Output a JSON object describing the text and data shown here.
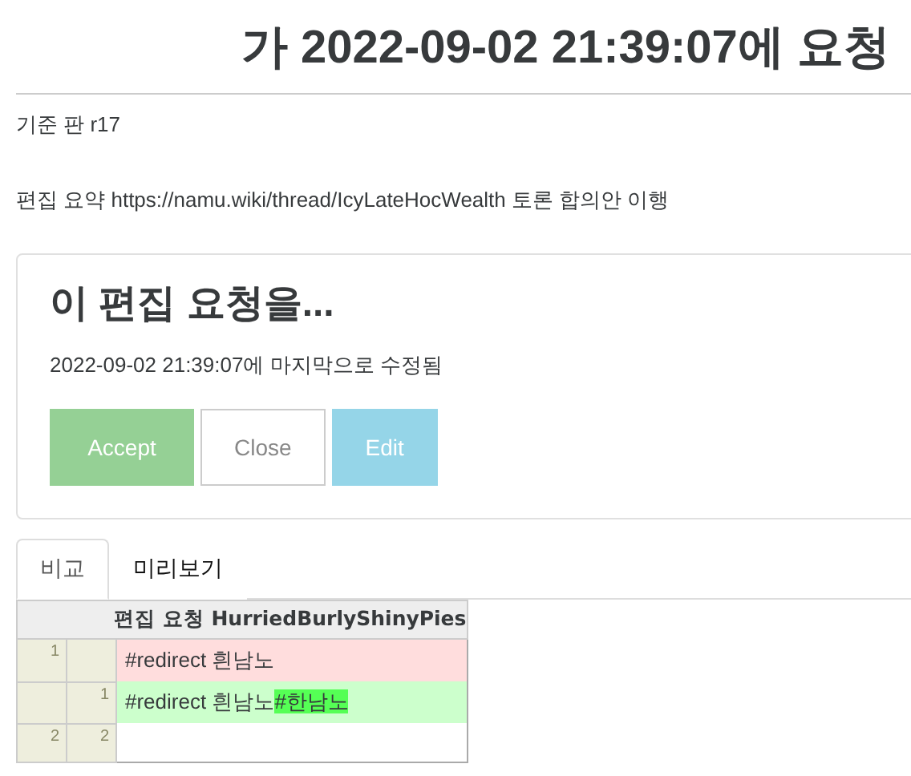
{
  "title": "가 2022-09-02 21:39:07에 요청",
  "base_revision": "기준 판 r17",
  "edit_summary": "편집 요약 https://namu.wiki/thread/IcyLateHocWealth 토론 합의안 이행",
  "action_card": {
    "heading": "이 편집 요청을...",
    "modified": "2022-09-02 21:39:07에 마지막으로 수정됨",
    "buttons": [
      {
        "label": "Accept",
        "kind": "accept"
      },
      {
        "label": "Close",
        "kind": "close"
      },
      {
        "label": "Edit",
        "kind": "edit"
      }
    ]
  },
  "tabs": [
    {
      "label": "비교",
      "selected": true
    },
    {
      "label": "미리보기",
      "selected": false
    }
  ],
  "diff": {
    "header": "편집 요청 HurriedBurlyShinyPies",
    "rows": [
      {
        "kind": "delete",
        "old_line": "1",
        "new_line": "",
        "segments": [
          {
            "text": "#redirect 흰남노",
            "highlight": false
          }
        ]
      },
      {
        "kind": "insert",
        "old_line": "",
        "new_line": "1",
        "segments": [
          {
            "text": "#redirect 흰남노",
            "highlight": false
          },
          {
            "text": "#한남노",
            "highlight": true
          }
        ]
      },
      {
        "kind": "equal",
        "old_line": "2",
        "new_line": "2",
        "segments": []
      }
    ]
  }
}
